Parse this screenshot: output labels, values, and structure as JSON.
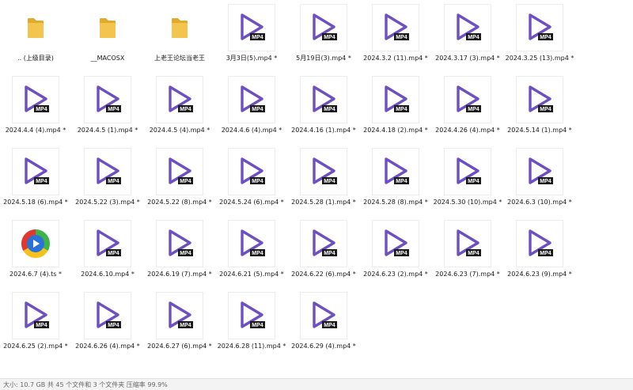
{
  "items": [
    {
      "label": ".. (上级目录)",
      "type": "folder",
      "icon": "folder-icon"
    },
    {
      "label": "__MACOSX",
      "type": "folder",
      "icon": "folder-icon"
    },
    {
      "label": "上老王论坛当老王",
      "type": "folder",
      "icon": "folder-icon"
    },
    {
      "label": "3月3日(5).mp4 *",
      "type": "mp4",
      "icon": "mp4-video-icon"
    },
    {
      "label": "5月19日(3).mp4 *",
      "type": "mp4",
      "icon": "mp4-video-icon"
    },
    {
      "label": "2024.3.2 (11).mp4 *",
      "type": "mp4",
      "icon": "mp4-video-icon"
    },
    {
      "label": "2024.3.17 (3).mp4 *",
      "type": "mp4",
      "icon": "mp4-video-icon"
    },
    {
      "label": "2024.3.25 (13).mp4 *",
      "type": "mp4",
      "icon": "mp4-video-icon"
    },
    {
      "label": "2024.4.4 (4).mp4 *",
      "type": "mp4",
      "icon": "mp4-video-icon"
    },
    {
      "label": "2024.4.5 (1).mp4 *",
      "type": "mp4",
      "icon": "mp4-video-icon"
    },
    {
      "label": "2024.4.5 (4).mp4 *",
      "type": "mp4",
      "icon": "mp4-video-icon"
    },
    {
      "label": "2024.4.6 (4).mp4 *",
      "type": "mp4",
      "icon": "mp4-video-icon"
    },
    {
      "label": "2024.4.16 (1).mp4 *",
      "type": "mp4",
      "icon": "mp4-video-icon"
    },
    {
      "label": "2024.4.18 (2).mp4 *",
      "type": "mp4",
      "icon": "mp4-video-icon"
    },
    {
      "label": "2024.4.26 (4).mp4 *",
      "type": "mp4",
      "icon": "mp4-video-icon"
    },
    {
      "label": "2024.5.14 (1).mp4 *",
      "type": "mp4",
      "icon": "mp4-video-icon"
    },
    {
      "label": "2024.5.18 (6).mp4 *",
      "type": "mp4",
      "icon": "mp4-video-icon"
    },
    {
      "label": "2024.5.22 (3).mp4 *",
      "type": "mp4",
      "icon": "mp4-video-icon"
    },
    {
      "label": "2024.5.22 (8).mp4 *",
      "type": "mp4",
      "icon": "mp4-video-icon"
    },
    {
      "label": "2024.5.24 (6).mp4 *",
      "type": "mp4",
      "icon": "mp4-video-icon"
    },
    {
      "label": "2024.5.28 (1).mp4 *",
      "type": "mp4",
      "icon": "mp4-video-icon"
    },
    {
      "label": "2024.5.28 (8).mp4 *",
      "type": "mp4",
      "icon": "mp4-video-icon"
    },
    {
      "label": "2024.5.30 (10).mp4 *",
      "type": "mp4",
      "icon": "mp4-video-icon"
    },
    {
      "label": "2024.6.3 (10).mp4 *",
      "type": "mp4",
      "icon": "mp4-video-icon"
    },
    {
      "label": "2024.6.7 (4).ts *",
      "type": "ts",
      "icon": "media-player-icon"
    },
    {
      "label": "2024.6.10.mp4 *",
      "type": "mp4",
      "icon": "mp4-video-icon"
    },
    {
      "label": "2024.6.19 (7).mp4 *",
      "type": "mp4",
      "icon": "mp4-video-icon"
    },
    {
      "label": "2024.6.21 (5).mp4 *",
      "type": "mp4",
      "icon": "mp4-video-icon"
    },
    {
      "label": "2024.6.22 (6).mp4 *",
      "type": "mp4",
      "icon": "mp4-video-icon"
    },
    {
      "label": "2024.6.23 (2).mp4 *",
      "type": "mp4",
      "icon": "mp4-video-icon"
    },
    {
      "label": "2024.6.23 (7).mp4 *",
      "type": "mp4",
      "icon": "mp4-video-icon"
    },
    {
      "label": "2024.6.23 (9).mp4 *",
      "type": "mp4",
      "icon": "mp4-video-icon"
    },
    {
      "label": "2024.6.25 (2).mp4 *",
      "type": "mp4",
      "icon": "mp4-video-icon"
    },
    {
      "label": "2024.6.26 (4).mp4 *",
      "type": "mp4",
      "icon": "mp4-video-icon"
    },
    {
      "label": "2024.6.27 (6).mp4 *",
      "type": "mp4",
      "icon": "mp4-video-icon"
    },
    {
      "label": "2024.6.28 (11).mp4 *",
      "type": "mp4",
      "icon": "mp4-video-icon"
    },
    {
      "label": "2024.6.29 (4).mp4 *",
      "type": "mp4",
      "icon": "mp4-video-icon"
    }
  ],
  "icon_text": {
    "mp4_badge": "MP4"
  },
  "colors": {
    "play_purple": "#6e4fc2",
    "badge_black": "#1b1b1b",
    "folder_yellow": "#f3c44e",
    "folder_yellow_dark": "#e0ab2c",
    "media_blue": "#2a72d9",
    "media_green": "#3fb24a",
    "media_yellow": "#f4c21b",
    "media_red": "#e0382f"
  },
  "status_bar": {
    "text": "大小: 10.7 GB 共 45 个文件和 3 个文件夹 压缩率 99.9%"
  }
}
